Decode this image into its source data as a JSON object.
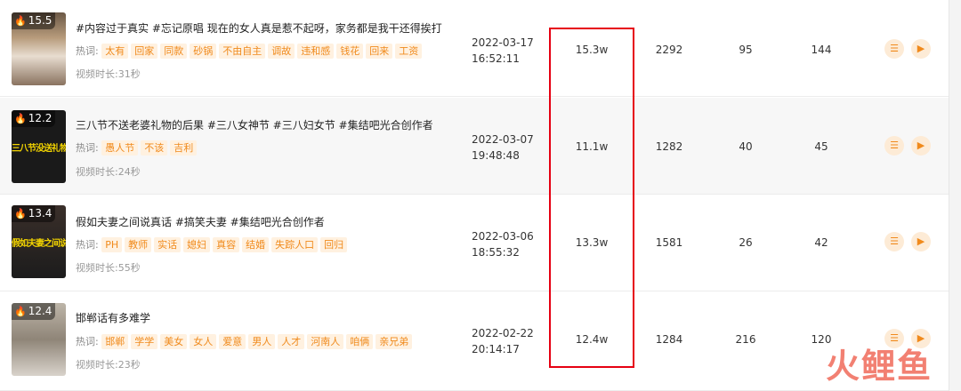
{
  "labels": {
    "hot": "热词:",
    "dur_prefix": "视频时长:"
  },
  "rows": [
    {
      "score": "15.5",
      "title": "#内容过于真实 #忘记原唱 现在的女人真是惹不起呀，家务都是我干还得挨打",
      "tags": [
        "太有",
        "回家",
        "同款",
        "砂锅",
        "不由自主",
        "调故",
        "违和感",
        "钱花",
        "回来",
        "工资"
      ],
      "duration": "31秒",
      "date": "2022-03-17",
      "time": "16:52:11",
      "plays": "15.3w",
      "likes": "2292",
      "comments": "95",
      "shares": "144",
      "cap": ""
    },
    {
      "score": "12.2",
      "title": "三八节不送老婆礼物的后果 #三八女神节 #三八妇女节 #集结吧光合创作者",
      "tags": [
        "愚人节",
        "不该",
        "吉利"
      ],
      "duration": "24秒",
      "date": "2022-03-07",
      "time": "19:48:48",
      "plays": "11.1w",
      "likes": "1282",
      "comments": "40",
      "shares": "45",
      "cap": "三八节没送礼物"
    },
    {
      "score": "13.4",
      "title": "假如夫妻之间说真话 #搞笑夫妻 #集结吧光合创作者",
      "tags": [
        "PH",
        "教师",
        "实话",
        "媳妇",
        "真容",
        "结婚",
        "失踪人口",
        "回归"
      ],
      "duration": "55秒",
      "date": "2022-03-06",
      "time": "18:55:32",
      "plays": "13.3w",
      "likes": "1581",
      "comments": "26",
      "shares": "42",
      "cap": "假如夫妻之间说真话"
    },
    {
      "score": "12.4",
      "title": "邯郸话有多难学",
      "tags": [
        "邯郸",
        "学学",
        "美女",
        "女人",
        "爱意",
        "男人",
        "人才",
        "河南人",
        "咱俩",
        "亲兄弟"
      ],
      "duration": "23秒",
      "date": "2022-02-22",
      "time": "20:14:17",
      "plays": "12.4w",
      "likes": "1284",
      "comments": "216",
      "shares": "120",
      "cap": ""
    }
  ],
  "icons": {
    "detail": "list-icon",
    "play": "play-icon",
    "fire": "fire-icon"
  },
  "watermark": "火鲤鱼",
  "colors": {
    "accent": "#f08a1c",
    "tag_bg": "#fff1e0",
    "highlight": "#e60012"
  }
}
